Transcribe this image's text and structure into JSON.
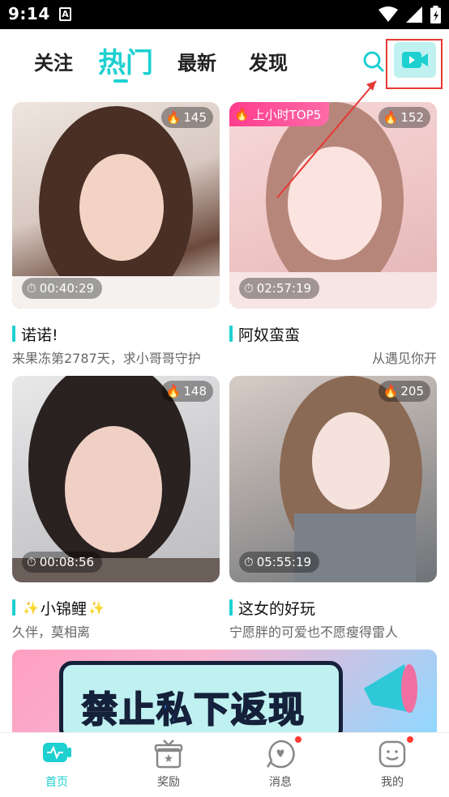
{
  "status_bar": {
    "time": "9:14",
    "notification_icon": "A",
    "icons": [
      "wifi-icon",
      "signal-icon",
      "battery-icon"
    ]
  },
  "top_nav": {
    "tabs": [
      {
        "label": "关注",
        "active": false
      },
      {
        "label": "热门",
        "active": true
      },
      {
        "label": "最新",
        "active": false
      },
      {
        "label": "发现",
        "active": false
      }
    ],
    "search_icon": "search-icon",
    "live_icon": "video-camera-icon",
    "accent_color": "#1ed0d0"
  },
  "cards": [
    {
      "heat": "145",
      "duration": "00:40:29",
      "title": "诺诺!",
      "subtitle": "来果冻第2787天，求小哥哥守护",
      "top_badge": ""
    },
    {
      "heat": "152",
      "duration": "02:57:19",
      "title": "阿奴蛮蛮",
      "subtitle": "从遇见你开",
      "top_badge": "上小时TOP5"
    },
    {
      "heat": "148",
      "duration": "00:08:56",
      "title": "小锦鲤",
      "subtitle": "久伴，莫相离",
      "top_badge": ""
    },
    {
      "heat": "205",
      "duration": "05:55:19",
      "title": "这女的好玩",
      "subtitle": "宁愿胖的可爱也不愿瘦得雷人",
      "top_badge": ""
    }
  ],
  "banner": {
    "text_part1": "禁止",
    "text_part2": "私下",
    "text_part3": "返现"
  },
  "bottom_nav": {
    "items": [
      {
        "label": "首页",
        "icon": "home-tv-icon",
        "active": true
      },
      {
        "label": "奖励",
        "icon": "gift-icon",
        "active": false
      },
      {
        "label": "消息",
        "icon": "message-icon",
        "active": false
      },
      {
        "label": "我的",
        "icon": "profile-icon",
        "active": false
      }
    ]
  }
}
